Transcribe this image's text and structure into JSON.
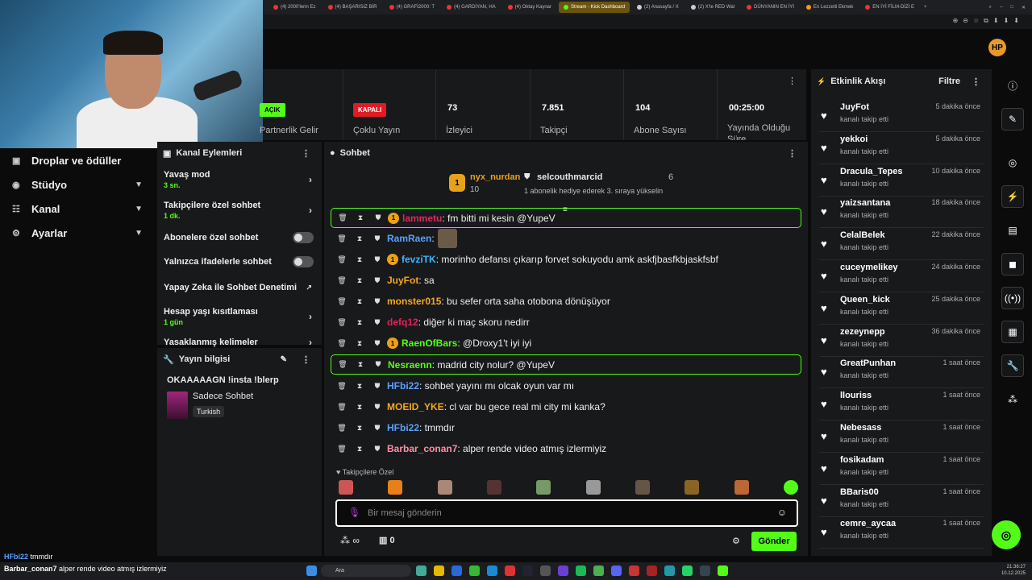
{
  "browser": {
    "tabs": [
      {
        "label": "(4) 2000'lerin Ez"
      },
      {
        "label": "(4) BAŞARISIZ BİR"
      },
      {
        "label": "(4) GRAFİ2000: T"
      },
      {
        "label": "(4) GARDİYAN, HA"
      },
      {
        "label": "(4) Oktay Kaynar"
      },
      {
        "label": "Stream - Kick Dashboard"
      },
      {
        "label": "(2) Anasayfa / X"
      },
      {
        "label": "(2) X'te RED Wal"
      },
      {
        "label": "DÜNYANIN EN İYİ"
      },
      {
        "label": "En Lezzetli Ekmek"
      },
      {
        "label": "EN İYİ FİLM-DİZİ E"
      }
    ],
    "logo_text": "HP"
  },
  "left_nav": {
    "items": [
      {
        "label": "Droplar ve ödüller",
        "icon": "gift-icon"
      },
      {
        "label": "Stüdyo",
        "icon": "studio-icon"
      },
      {
        "label": "Kanal",
        "icon": "channel-icon"
      },
      {
        "label": "Ayarlar",
        "icon": "gear-icon"
      }
    ]
  },
  "stats": {
    "partner_badge": "AÇIK",
    "partner_label": "Partnerlik Gelir",
    "multistream_badge": "KAPALI",
    "multistream_label": "Çoklu Yayın",
    "viewers_value": "73",
    "viewers_label": "İzleyici",
    "followers_value": "7.851",
    "followers_label": "Takipçi",
    "subs_value": "104",
    "subs_label": "Abone Sayısı",
    "uptime_value": "00:25:00",
    "uptime_label": "Yayında Olduğu Süre"
  },
  "channel_actions": {
    "title": "Kanal Eylemleri",
    "slow_mode": "Yavaş mod",
    "slow_mode_value": "3 sn.",
    "followers_only": "Takipçilere özel sohbet",
    "followers_only_value": "1 dk.",
    "subs_only": "Abonelere özel sohbet",
    "emotes_only": "Yalnızca ifadelerle sohbet",
    "ai_moderation": "Yapay Zeka ile Sohbet Denetimi",
    "account_age": "Hesap yaşı kısıtlaması",
    "account_age_value": "1 gün",
    "banned_words": "Yasaklanmış kelimeler"
  },
  "stream_info": {
    "title": "Yayın bilgisi",
    "stream_title": "OKAAAAAGN !insta !blerp",
    "category": "Sadece Sohbet",
    "language": "Turkish"
  },
  "chat": {
    "title": "Sohbet",
    "pinned": {
      "user1": "nyx_nurdan",
      "user1_count": "10",
      "user2": "selcouthmarcid",
      "user2_count": "6",
      "note": "1 abonelik hediye ederek 3. sıraya yükselin"
    },
    "messages": [
      {
        "user": "lammetu",
        "text": ": fm bitti mi kesin @YupeV",
        "color": "#e0245e",
        "highlight": true,
        "sub": true
      },
      {
        "user": "RamRaen",
        "text": ":",
        "color": "#5aa0ff",
        "emote": true
      },
      {
        "user": "fevziTK",
        "text": ": morinho defansı çıkarıp forvet sokuyodu amk askfjbasfkbjaskfsbf",
        "color": "#3db8ff",
        "sub": true
      },
      {
        "user": "JuyFot",
        "text": ": sa",
        "color": "#f5a623"
      },
      {
        "user": "monster015",
        "text": ": bu sefer orta saha otobona dönüşüyor",
        "color": "#f5a623"
      },
      {
        "user": "defq12",
        "text": ": diğer ki maç skoru nedirr",
        "color": "#e0245e"
      },
      {
        "user": "RaenOfBars",
        "text": ": @Droxy1't iyi iyi",
        "color": "#53fc18",
        "sub": true
      },
      {
        "user": "Nesraenn",
        "text": ": madrid city nolur? @YupeV",
        "color": "#53fc18",
        "highlight": true
      },
      {
        "user": "HFbi22",
        "text": ": sohbet yayını mı olcak oyun var mı",
        "color": "#5aa0ff"
      },
      {
        "user": "MOEID_YKE",
        "text": ": cl var bu gece real mi city mi kanka?",
        "color": "#f5a623"
      },
      {
        "user": "HFbi22",
        "text": ": tmmdır",
        "color": "#5aa0ff"
      },
      {
        "user": "Barbar_conan7",
        "text": ": alper rende video atmış izlermiyiz",
        "color": "#ff8fa3"
      }
    ],
    "followers_only_label": "Takipçilere Özel",
    "input_placeholder": "Bir mesaj gönderin",
    "points": "0",
    "send_label": "Gönder"
  },
  "activity": {
    "title": "Etkinlik Akışı",
    "filter_label": "Filtre",
    "items": [
      {
        "name": "JuyFot",
        "desc": "kanalı takip etti",
        "time": "5 dakika önce"
      },
      {
        "name": "yekkoi",
        "desc": "kanalı takip etti",
        "time": "5 dakika önce"
      },
      {
        "name": "Dracula_Tepes",
        "desc": "kanalı takip etti",
        "time": "10 dakika önce"
      },
      {
        "name": "yaizsantana",
        "desc": "kanalı takip etti",
        "time": "18 dakika önce"
      },
      {
        "name": "CelalBelek",
        "desc": "kanalı takip etti",
        "time": "22 dakika önce"
      },
      {
        "name": "cuceymelikey",
        "desc": "kanalı takip etti",
        "time": "24 dakika önce"
      },
      {
        "name": "Queen_kick",
        "desc": "kanalı takip etti",
        "time": "25 dakika önce"
      },
      {
        "name": "zezeynepp",
        "desc": "kanalı takip etti",
        "time": "36 dakika önce"
      },
      {
        "name": "GreatPunhan",
        "desc": "kanalı takip etti",
        "time": "1 saat önce"
      },
      {
        "name": "llouriss",
        "desc": "kanalı takip etti",
        "time": "1 saat önce"
      },
      {
        "name": "Nebesass",
        "desc": "kanalı takip etti",
        "time": "1 saat önce"
      },
      {
        "name": "fosikadam",
        "desc": "kanalı takip etti",
        "time": "1 saat önce"
      },
      {
        "name": "BBaris00",
        "desc": "kanalı takip etti",
        "time": "1 saat önce"
      },
      {
        "name": "cemre_aycaa",
        "desc": "kanalı takip etti",
        "time": "1 saat önce"
      }
    ]
  },
  "overlay_chat": [
    {
      "user": "HFbi22",
      "text": "tmmdır"
    },
    {
      "user": "Barbar_conan7",
      "text": "alper rende video atmış izlermiyiz"
    }
  ],
  "taskbar": {
    "search": "Ara",
    "time": "21:36:27",
    "date": "10.12.2025"
  },
  "colors": {
    "accent": "#53fc18",
    "panel": "#18191b",
    "danger": "#e01b24"
  }
}
